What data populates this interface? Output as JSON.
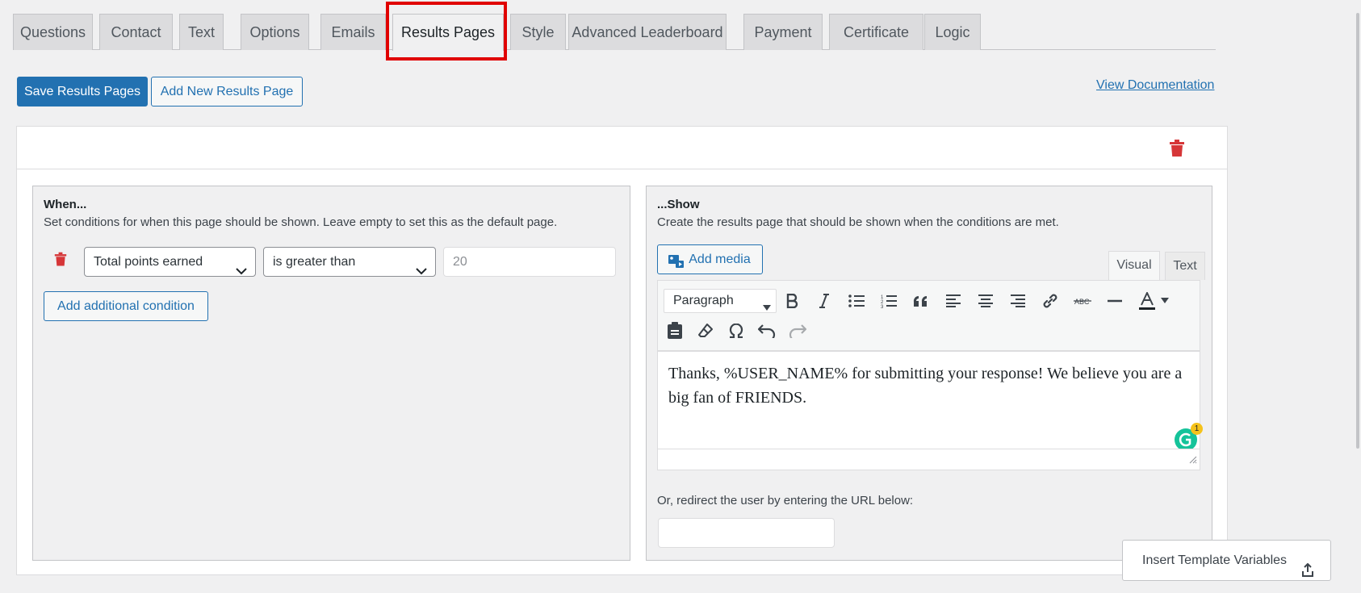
{
  "tabs": [
    {
      "label": "Questions"
    },
    {
      "label": "Contact"
    },
    {
      "label": "Text"
    },
    {
      "label": "Options"
    },
    {
      "label": "Emails"
    },
    {
      "label": "Results Pages"
    },
    {
      "label": "Style"
    },
    {
      "label": "Advanced Leaderboard"
    },
    {
      "label": "Payment"
    },
    {
      "label": "Certificate"
    },
    {
      "label": "Logic"
    }
  ],
  "actions": {
    "save_label": "Save Results Pages",
    "add_label": "Add New Results Page",
    "doc_link": "View Documentation"
  },
  "when_panel": {
    "title": "When...",
    "description": "Set conditions for when this page should be shown. Leave empty to set this as the default page.",
    "condition": {
      "field": "Total points earned",
      "operator": "is greater than",
      "value": "20"
    },
    "add_condition_label": "Add additional condition"
  },
  "show_panel": {
    "title": "...Show",
    "description": "Create the results page that should be shown when the conditions are met.",
    "add_media_label": "Add media",
    "visual_tab": "Visual",
    "text_tab": "Text",
    "format_select": "Paragraph",
    "content": "Thanks, %USER_NAME% for submitting your response!  We believe you are a big fan of FRIENDS.",
    "grammarly_count": "1",
    "redirect_label": "Or, redirect the user by entering the URL below:",
    "redirect_value": ""
  },
  "insert_template_label": "Insert Template Variables",
  "colors": {
    "accent": "#2271b1",
    "danger": "#d63638",
    "highlight": "#e00000"
  }
}
